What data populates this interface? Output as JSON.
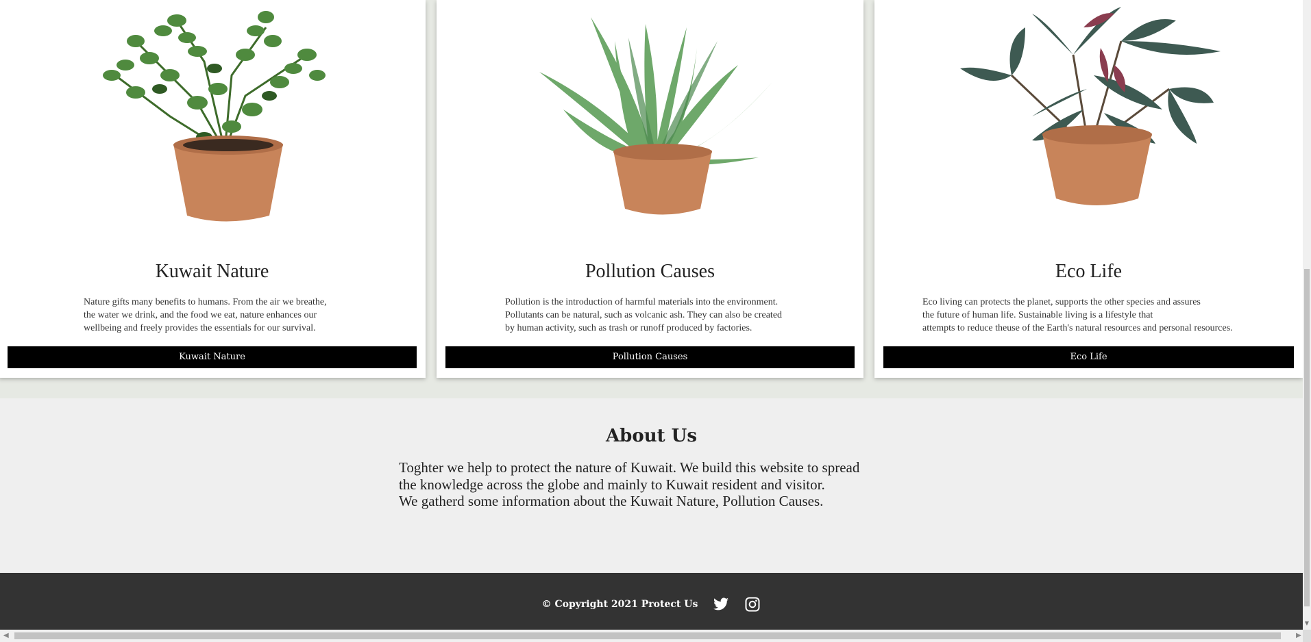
{
  "cards": [
    {
      "title": "Kuwait Nature",
      "text": "Nature gifts many benefits to humans. From the air we breathe,\nthe water we drink, and the food we eat, nature enhances our\nwellbeing and freely provides the essentials for our survival.",
      "button": "Kuwait Nature",
      "image": "potted-zz-plant-illustration"
    },
    {
      "title": "Pollution Causes",
      "text": "Pollution is the introduction of harmful materials into the environment.\nPollutants can be natural, such as volcanic ash. They can also be created\nby human activity, such as trash or runoff produced by factories.",
      "button": "Pollution Causes",
      "image": "potted-aloe-plant-illustration"
    },
    {
      "title": "Eco Life",
      "text": "Eco living can protects the planet, supports the other species and assures\nthe future of human life. Sustainable living is a lifestyle that\nattempts to reduce theuse of the Earth's natural resources and personal resources.",
      "button": "Eco Life",
      "image": "potted-rubber-plant-illustration"
    }
  ],
  "about": {
    "title": "About Us",
    "text": "Toghter we help to protect the nature of Kuwait. We build this website to spread\nthe knowledge across the globe and mainly to Kuwait resident and visitor.\nWe gatherd some information about the Kuwait Nature, Pollution Causes."
  },
  "footer": {
    "copyright": "© Copyright 2021 Protect Us",
    "icons": [
      "twitter-icon",
      "instagram-icon"
    ]
  },
  "colors": {
    "page_background": "#e9ece6",
    "card_background": "#ffffff",
    "button_background": "#000000",
    "about_background": "#efefef",
    "footer_background": "#333333",
    "pot": "#c8845a",
    "leaf_green": "#4f8a3e",
    "leaf_dark": "#3e5a52",
    "leaf_red": "#8a3d4f"
  }
}
